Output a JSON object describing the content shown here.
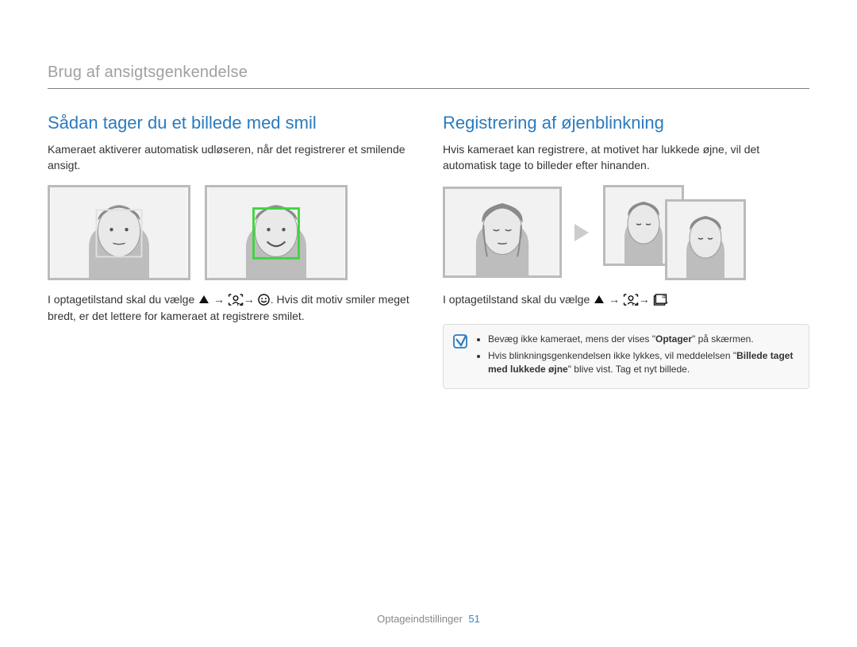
{
  "header": {
    "section_title": "Brug af ansigtsgenkendelse"
  },
  "left": {
    "heading": "Sådan tager du et billede med smil",
    "intro": "Kameraet aktiverer automatisk udløseren, når det registrerer et smilende ansigt.",
    "instr_prefix": "I optagetilstand skal du vælge ",
    "instr_suffix_a": ". Hvis dit motiv smiler meget bredt, er det lettere for kameraet at registrere smilet."
  },
  "right": {
    "heading": "Registrering af øjenblinkning",
    "intro": "Hvis kameraet kan registrere, at motivet har lukkede øjne, vil det automatisk tage to billeder efter hinanden.",
    "instr_prefix": "I optagetilstand skal du vælge ",
    "note_items": {
      "a_prefix": "Bevæg ikke kameraet, mens der vises \"",
      "a_bold": "Optager",
      "a_suffix": "\" på skærmen.",
      "b_prefix": "Hvis blinkningsgenkendelsen ikke lykkes, vil meddelelsen \"",
      "b_bold": "Billede taget med lukkede øjne",
      "b_suffix": "\" blive vist. Tag et nyt billede."
    }
  },
  "icons": {
    "up_triangle": "up-triangle-icon",
    "face_detect_off": "face-detect-off-icon",
    "smile_icon": "smile-mode-icon",
    "blink_icon": "blink-mode-icon",
    "arrow_right": "→"
  },
  "footer": {
    "label": "Optageindstillinger",
    "page": "51"
  }
}
